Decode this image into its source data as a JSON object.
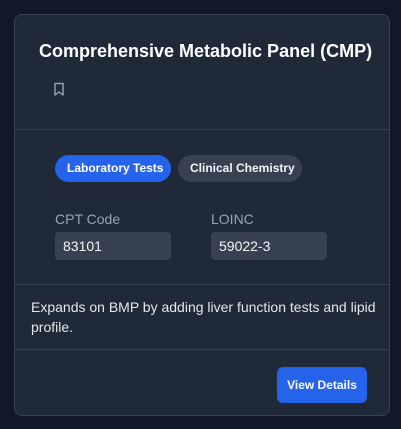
{
  "card": {
    "title": "Comprehensive Metabolic Panel (CMP)",
    "bookmark_icon": "bookmark-icon",
    "tags": [
      {
        "label": "Laboratory Tests",
        "color": "#2563eb"
      },
      {
        "label": "Clinical Chemistry",
        "color": "#374151"
      }
    ],
    "codes": {
      "cpt_label": "CPT Code",
      "cpt_value": "83101",
      "loinc_label": "LOINC",
      "loinc_value": "59022-3"
    },
    "description": "Expands on BMP by adding liver function tests and lipid profile.",
    "action_label": "View Details"
  },
  "colors": {
    "page_background": "#111827",
    "card_background": "#1f2937",
    "border": "#374151",
    "accent": "#2563eb"
  }
}
